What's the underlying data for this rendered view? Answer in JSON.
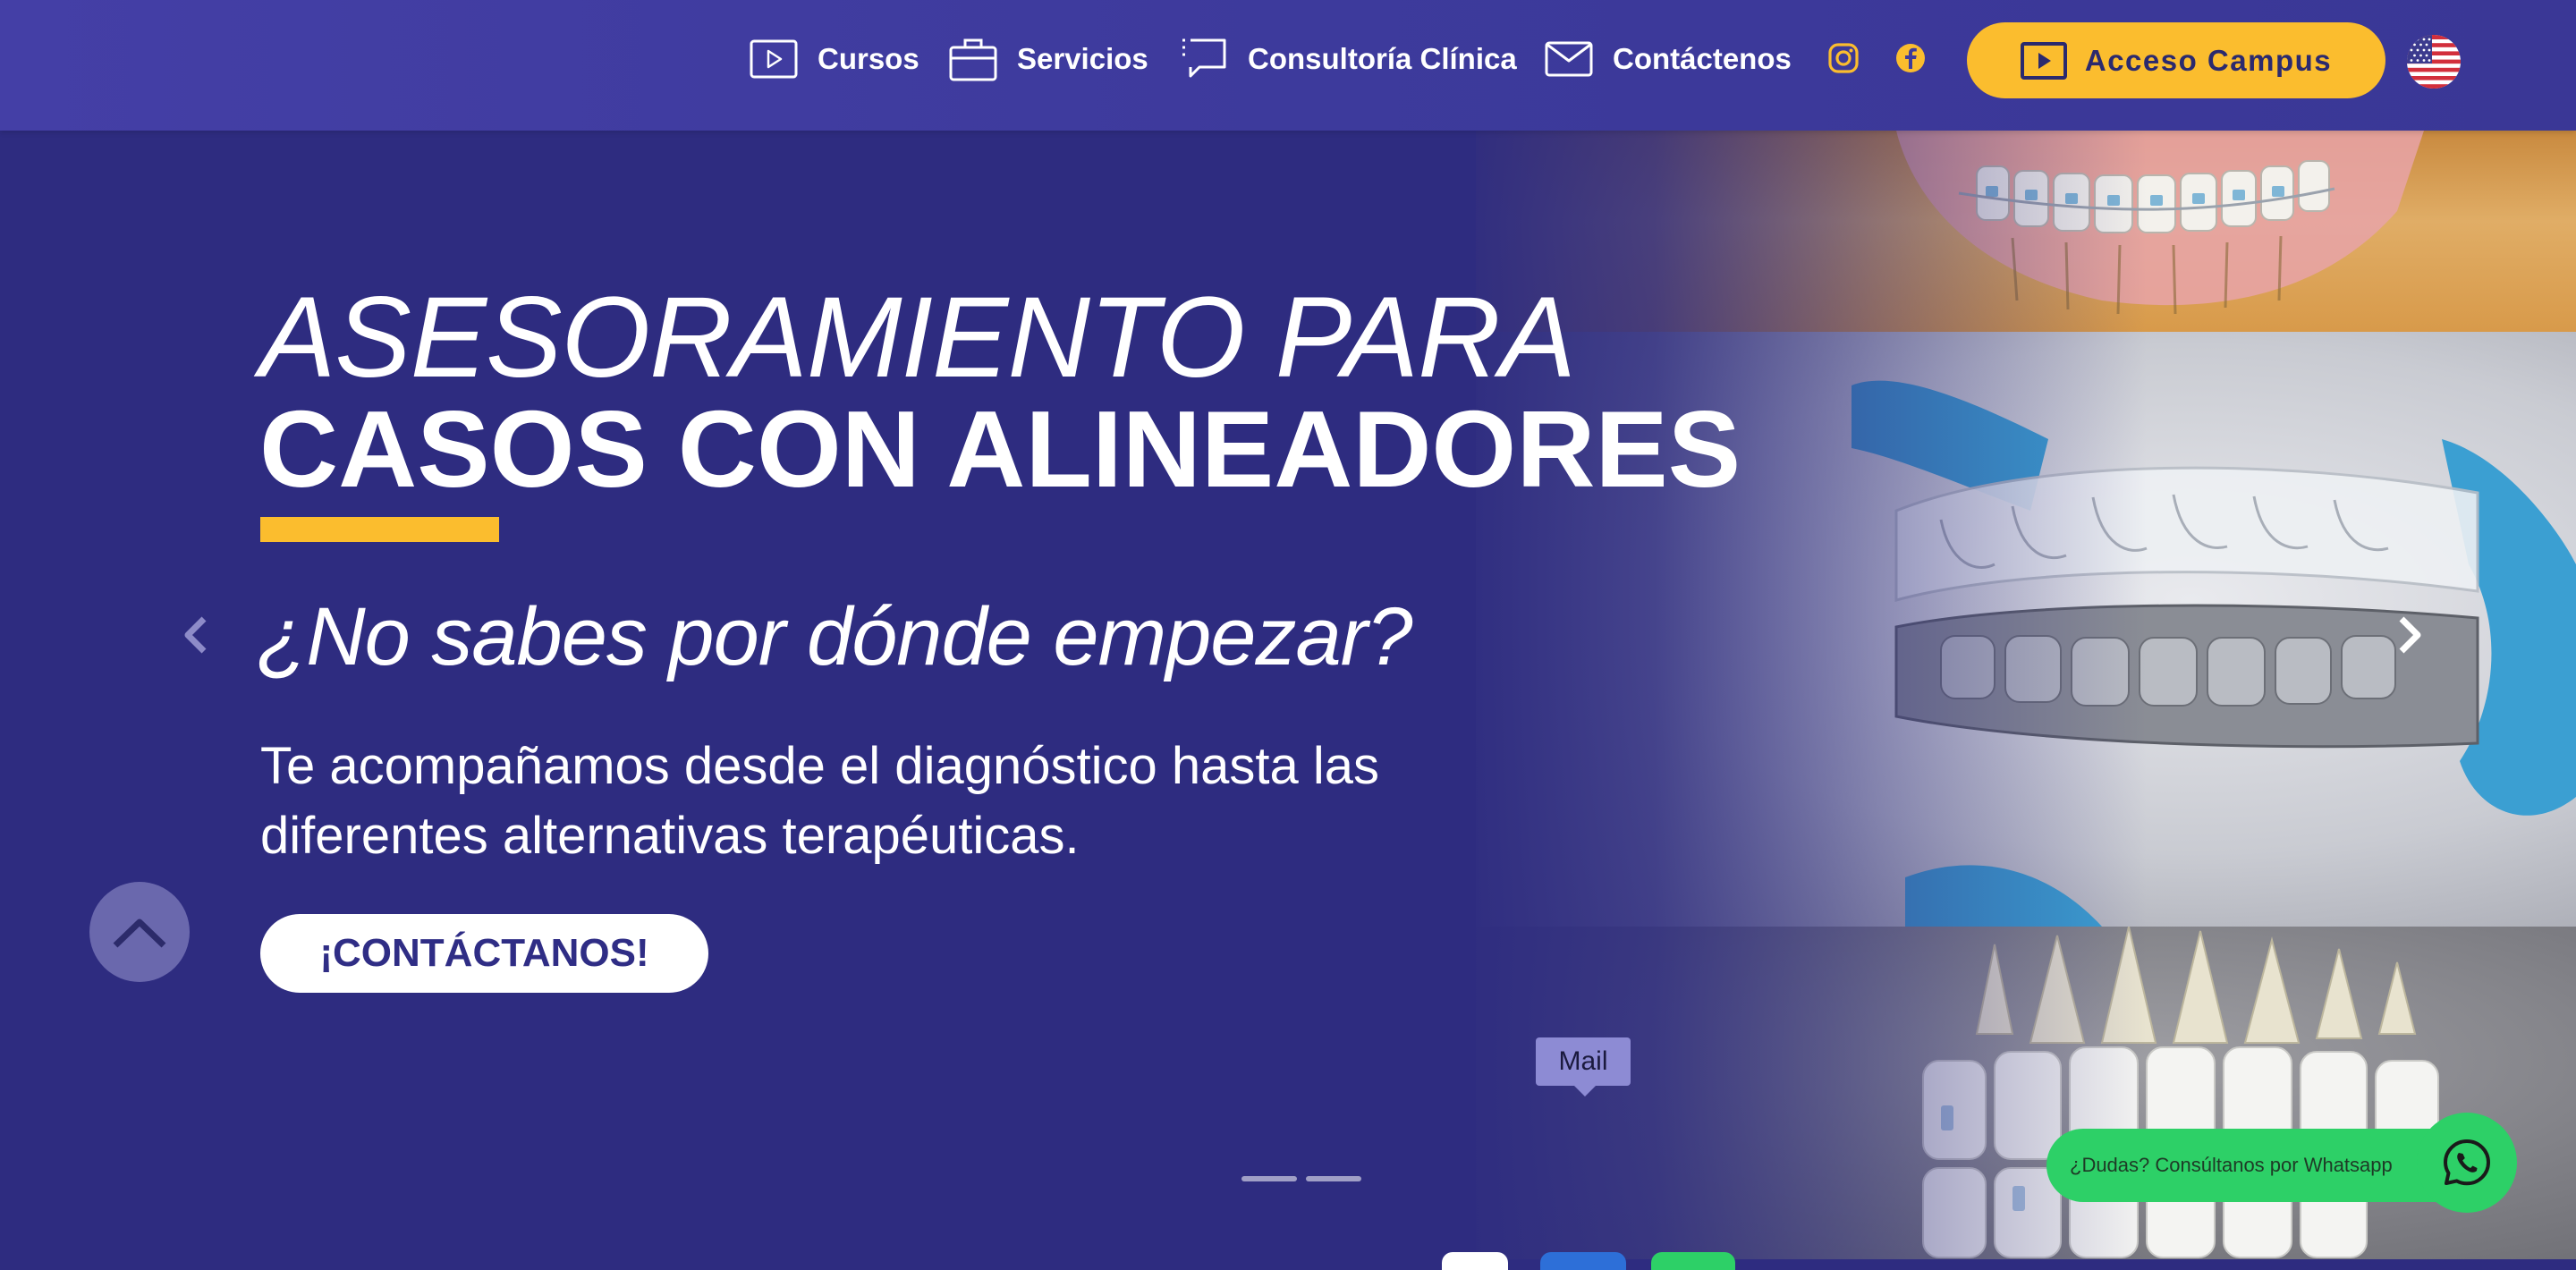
{
  "nav": {
    "items": [
      {
        "label": "Cursos",
        "icon": "play-square-icon"
      },
      {
        "label": "Servicios",
        "icon": "briefcase-icon"
      },
      {
        "label": "Consultoría Clínica",
        "icon": "chat-bubble-icon"
      },
      {
        "label": "Contáctenos",
        "icon": "mail-icon"
      }
    ],
    "social": [
      "instagram-icon",
      "facebook-icon"
    ],
    "campus_button": "Acceso Campus",
    "language_flag": "us-flag-icon"
  },
  "hero": {
    "headline_light": "ASESORAMIENTO PARA",
    "headline_bold": "CASOS CON ALINEADORES",
    "subheadline": "¿No sabes por dónde empezar?",
    "description": "Te acompañamos desde el diagnóstico hasta las diferentes alternativas terapéuticas.",
    "cta": "¡CONTÁCTANOS!",
    "slides": 2
  },
  "floating": {
    "tooltip": "Mail",
    "whatsapp_label": "¿Dudas? Consúltanos por Whatsapp"
  },
  "colors": {
    "nav_bg": "#3d3a9c",
    "hero_bg": "#2e2c80",
    "accent_yellow": "#fbbd2e",
    "whatsapp_green": "#2dd067",
    "tooltip_bg": "#8d8bd4"
  }
}
